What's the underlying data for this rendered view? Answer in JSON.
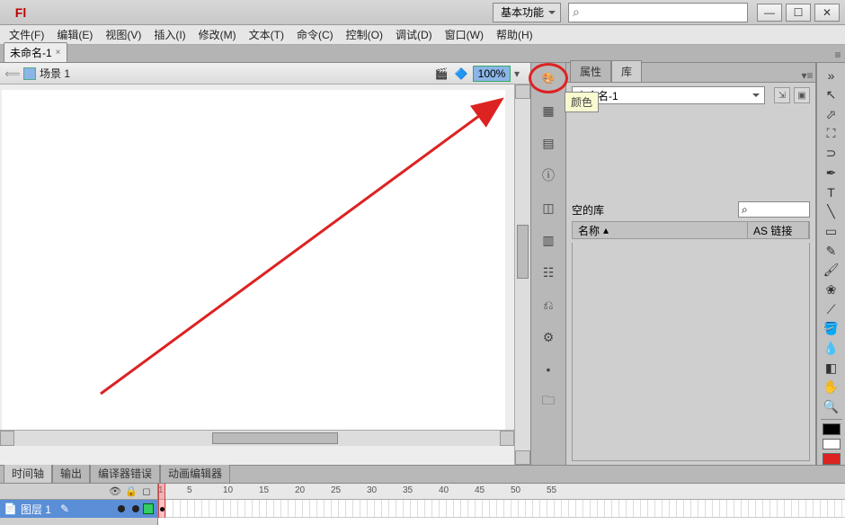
{
  "titlebar": {
    "logo": "Fl",
    "workspace": "基本功能",
    "search_placeholder": ""
  },
  "menu": [
    "文件(F)",
    "编辑(E)",
    "视图(V)",
    "插入(I)",
    "修改(M)",
    "文本(T)",
    "命令(C)",
    "控制(O)",
    "调试(D)",
    "窗口(W)",
    "帮助(H)"
  ],
  "doc": {
    "tab": "未命名-1"
  },
  "scene": {
    "name": "场景 1",
    "zoom": "100%"
  },
  "mid_tooltip": "颜色",
  "panels": {
    "tabs": [
      "属性",
      "库"
    ],
    "lib_doc": "未命名-1",
    "empty_text": "空的库",
    "columns": [
      "名称",
      "AS 链接"
    ]
  },
  "timeline": {
    "tabs": [
      "时间轴",
      "输出",
      "编译器错误",
      "动画编辑器"
    ],
    "layer": "图层 1",
    "ticks": [
      1,
      5,
      10,
      15,
      20,
      25,
      30,
      35,
      40,
      45,
      50,
      55
    ]
  }
}
